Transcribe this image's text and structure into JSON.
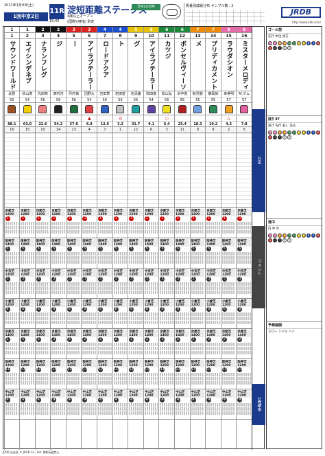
{
  "header": {
    "date": "2021年1月9日(土)",
    "meeting": "1回中京2日",
    "race_no": "11R",
    "post_time": "15:45",
    "race_name": "淀短距離ステークス",
    "conditions": "4歳以上オープン",
    "conditions2": "(国際)(特指) 別定",
    "course": "芝A1200M",
    "sheet_title": "馬番別成績分布 サンプル数 : 2",
    "logo": "JRDB",
    "logo_url": "http://www.jrdb.com/"
  },
  "horses": [
    {
      "umaban": "16",
      "waku": "8",
      "name": "ミスターメロディ",
      "jockey": "M.デム",
      "weight": "57",
      "mark": "",
      "odds": "7.8",
      "pop": "5",
      "silk": "#e060a0"
    },
    {
      "umaban": "15",
      "waku": "8",
      "name": "ラウダシオン",
      "jockey": "幸英明",
      "weight": "57",
      "mark": "△",
      "odds": "4.3",
      "pop": "2",
      "silk": "#f4a020"
    },
    {
      "umaban": "14",
      "waku": "7",
      "name": "プリディカメント",
      "jockey": "藤岡佑",
      "weight": "55",
      "mark": "",
      "odds": "19.2",
      "pop": "9",
      "silk": "#2e8b57"
    },
    {
      "umaban": "13",
      "waku": "7",
      "name": "メイショウカズヒメ",
      "jockey": "鮫島駿",
      "weight": "55",
      "mark": "",
      "odds": "18.3",
      "pop": "8",
      "silk": "#70a0e0"
    },
    {
      "umaban": "12",
      "waku": "6",
      "name": "ボンセルヴィーソ",
      "jockey": "浜中俊",
      "weight": "56",
      "mark": "",
      "odds": "25.4",
      "pop": "11",
      "silk": "#b02020"
    },
    {
      "umaban": "11",
      "waku": "6",
      "name": "カツジ",
      "jockey": "松山弘",
      "weight": "56",
      "mark": "○",
      "odds": "6.4",
      "pop": "3",
      "silk": "#f0e020"
    },
    {
      "umaban": "10",
      "waku": "5",
      "name": "アイラブテーラー",
      "jockey": "和田竜",
      "weight": "54",
      "mark": "",
      "odds": "9.1",
      "pop": "6",
      "silk": "#6040a0"
    },
    {
      "umaban": "9",
      "waku": "5",
      "name": "レインボーフラッグ",
      "jockey": "池添謙",
      "weight": "56",
      "mark": "",
      "odds": "31.7",
      "pop": "12",
      "silk": "#20a0a0"
    },
    {
      "umaban": "8",
      "waku": "4",
      "name": "ヴェスターヴァルト",
      "jockey": "岩田望",
      "weight": "56",
      "mark": "◎",
      "odds": "3.2",
      "pop": "1",
      "silk": "#c0c0c0"
    },
    {
      "umaban": "7",
      "waku": "4",
      "name": "ロードアクア",
      "jockey": "吉田隼",
      "weight": "56",
      "mark": "",
      "odds": "12.6",
      "pop": "7",
      "silk": "#3060c0"
    },
    {
      "umaban": "6",
      "waku": "3",
      "name": "アイラブテーラー",
      "jockey": "団野大",
      "weight": "54",
      "mark": "▲",
      "odds": "6.9",
      "pop": "4",
      "silk": "#e04040"
    },
    {
      "umaban": "5",
      "waku": "3",
      "name": "マイネルアルケミー",
      "jockey": "丹内祐",
      "weight": "56",
      "mark": "",
      "odds": "37.0",
      "pop": "13",
      "silk": "#207040"
    },
    {
      "umaban": "4",
      "waku": "2",
      "name": "メイショウキョウジ",
      "jockey": "西村淳",
      "weight": "56",
      "mark": "",
      "odds": "54.2",
      "pop": "14",
      "silk": "#202020"
    },
    {
      "umaban": "3",
      "waku": "2",
      "name": "ナランフレグ",
      "jockey": "丸田恭",
      "weight": "56",
      "mark": "",
      "odds": "22.6",
      "pop": "10",
      "silk": "#f08080"
    },
    {
      "umaban": "2",
      "waku": "1",
      "name": "エイシンデネブ",
      "jockey": "秋山真",
      "weight": "54",
      "mark": "",
      "odds": "63.0",
      "pop": "15",
      "silk": "#f4d000"
    },
    {
      "umaban": "1",
      "waku": "1",
      "name": "サウンドワールド",
      "jockey": "武豊",
      "weight": "56",
      "mark": "",
      "odds": "88.1",
      "pop": "16",
      "silk": "#a05020"
    }
  ],
  "waku_colors": {
    "1": "#ffffff",
    "2": "#111111",
    "3": "#d22",
    "4": "#1a4fd0",
    "5": "#e8c400",
    "6": "#1c8a3a",
    "7": "#f08a00",
    "8": "#e66aa8"
  },
  "runs": [
    {
      "course": "京都芝1200",
      "place": "1"
    },
    {
      "course": "阪神芝1400",
      "place": "5"
    },
    {
      "course": "中京芝1200",
      "place": "3"
    },
    {
      "course": "小倉芝1200",
      "place": "8"
    },
    {
      "course": "京都芝1400",
      "place": "2"
    },
    {
      "course": "阪神芝1200",
      "place": "11"
    },
    {
      "course": "中山芝1200",
      "place": "4"
    }
  ],
  "side_labels": {
    "top": "IDM",
    "mid": "コメント",
    "bottom": "1着確率"
  },
  "right_panels": {
    "goal": {
      "title": "ゴール前",
      "body": "先行 中位 後方"
    },
    "remain": {
      "title": "残り3F",
      "body": "逃げ 先行 差し 追込"
    },
    "mid": {
      "title": "道中",
      "body": "内 中 外"
    },
    "notes": {
      "title": "予想展開",
      "body": "スロー ミドル ハイ"
    }
  },
  "footer": "JRDB 出走表 © JRDB Co., Ltd. 無断転載禁止"
}
